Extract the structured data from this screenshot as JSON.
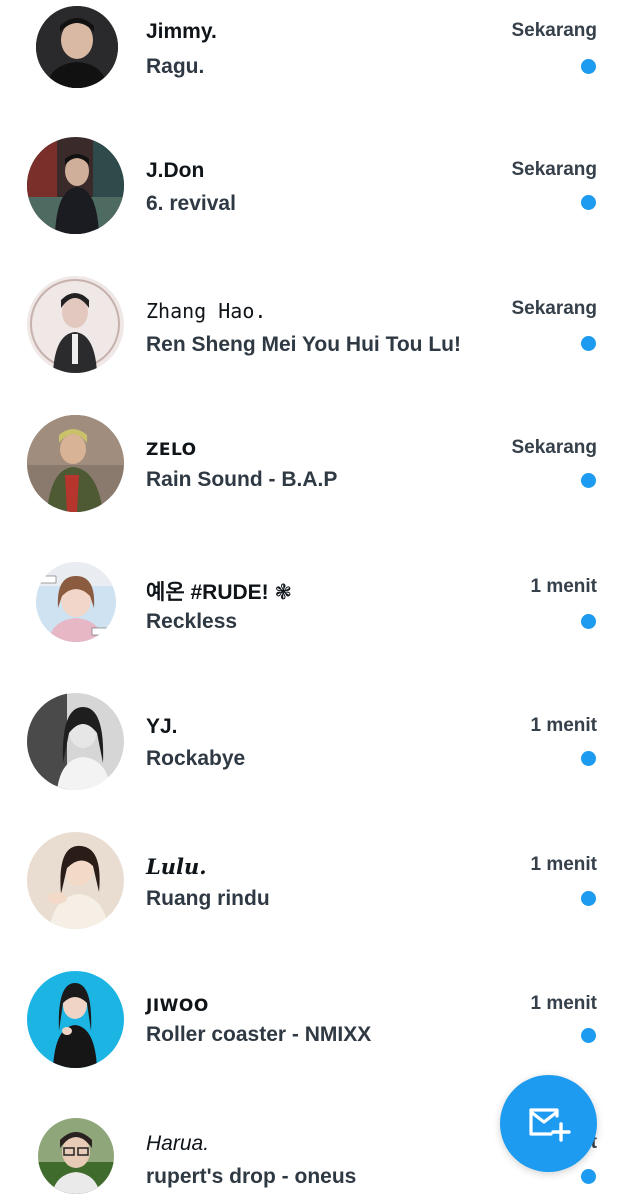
{
  "accent_color": "#1d9bf0",
  "conversations": [
    {
      "name": "Jimmy.",
      "message": "Ragu.",
      "time": "Sekarang",
      "unread": true
    },
    {
      "name": "J.Don",
      "message": "6. revival",
      "time": "Sekarang",
      "unread": true
    },
    {
      "name": "Zhang Hao.",
      "message": "Ren Sheng Mei You Hui Tou Lu!",
      "time": "Sekarang",
      "unread": true
    },
    {
      "name": "ZELO",
      "message": "Rain Sound - B.A.P",
      "time": "Sekarang",
      "unread": true
    },
    {
      "name": "예온 #RUDE! ❃",
      "message": "Reckless",
      "time": "1 menit",
      "unread": true
    },
    {
      "name": "YJ.",
      "message": "Rockabye",
      "time": "1 menit",
      "unread": true
    },
    {
      "name": "Lulu.",
      "message": "Ruang rindu",
      "time": "1 menit",
      "unread": true
    },
    {
      "name": "JIWOO",
      "message": "Roller coaster - NMIXX",
      "time": "1 menit",
      "unread": true
    },
    {
      "name": "Harua.",
      "message": "rupert's drop - oneus",
      "time": "t",
      "unread": true
    }
  ],
  "fab": {
    "icon": "new-message-icon"
  }
}
